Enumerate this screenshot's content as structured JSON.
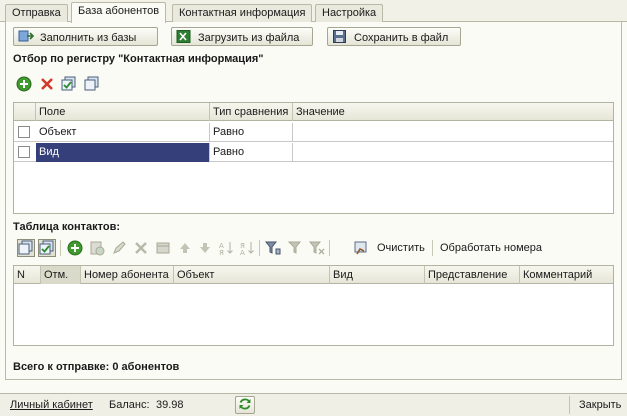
{
  "tabs": [
    {
      "label": "Отправка"
    },
    {
      "label": "База абонентов"
    },
    {
      "label": "Контактная информация"
    },
    {
      "label": "Настройка"
    }
  ],
  "actions": {
    "fill_from_base": "Заполнить из базы",
    "load_from_file": "Загрузить из файла",
    "save_to_file": "Сохранить в файл"
  },
  "filter": {
    "title": "Отбор по регистру \"Контактная информация\"",
    "columns": [
      "Поле",
      "Тип сравнения",
      "Значение"
    ],
    "rows": [
      {
        "field": "Объект",
        "comparison": "Равно",
        "value": "",
        "selected": false
      },
      {
        "field": "Вид",
        "comparison": "Равно",
        "value": "",
        "selected": true
      }
    ]
  },
  "contacts": {
    "title": "Таблица контактов:",
    "clear_label": "Очистить",
    "process_label": "Обработать номера",
    "columns": [
      "N",
      "Отм.",
      "Номер абонента",
      "Объект",
      "Вид",
      "Представление",
      "Комментарий"
    ]
  },
  "summary": "Всего к отправке: 0 абонентов",
  "status": {
    "account_link": "Личный кабинет",
    "balance_label": "Баланс:",
    "balance_value": "39.98",
    "close_label": "Закрыть"
  },
  "colors": {
    "selection": "#35407a",
    "add_green": "#3f9b2d",
    "delete_red": "#d23a2a"
  }
}
